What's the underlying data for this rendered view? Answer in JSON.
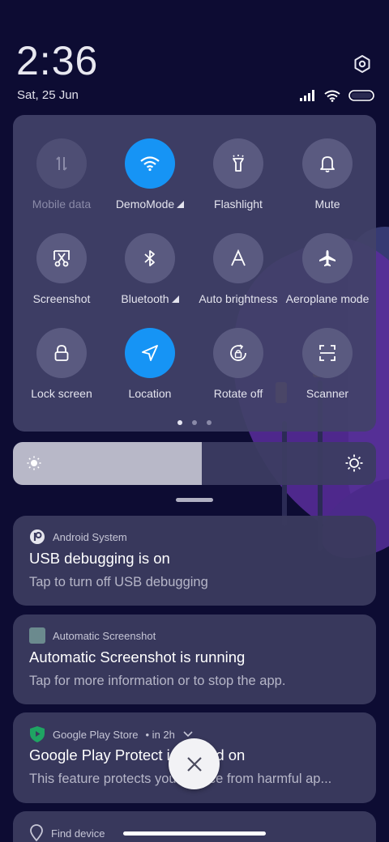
{
  "status": {
    "time": "2:36",
    "date": "Sat, 25 Jun"
  },
  "quick_settings": {
    "tiles": [
      {
        "label": "Mobile data",
        "icon": "mobile-data-icon",
        "state": "disabled"
      },
      {
        "label": "DemoMode",
        "icon": "wifi-icon",
        "state": "active",
        "expandable": true
      },
      {
        "label": "Flashlight",
        "icon": "flashlight-icon",
        "state": "off"
      },
      {
        "label": "Mute",
        "icon": "bell-icon",
        "state": "off"
      },
      {
        "label": "Screenshot",
        "icon": "screenshot-icon",
        "state": "off"
      },
      {
        "label": "Bluetooth",
        "icon": "bluetooth-icon",
        "state": "off",
        "expandable": true
      },
      {
        "label": "Auto brightness",
        "icon": "auto-brightness-icon",
        "state": "off"
      },
      {
        "label": "Aeroplane mode",
        "icon": "airplane-icon",
        "state": "off"
      },
      {
        "label": "Lock screen",
        "icon": "lock-icon",
        "state": "off"
      },
      {
        "label": "Location",
        "icon": "location-icon",
        "state": "active"
      },
      {
        "label": "Rotate off",
        "icon": "rotate-lock-icon",
        "state": "off"
      },
      {
        "label": "Scanner",
        "icon": "scanner-icon",
        "state": "off"
      }
    ],
    "page_count": 3,
    "current_page": 1
  },
  "brightness": {
    "level": 0.52
  },
  "notifications": [
    {
      "app": "Android System",
      "app_icon": "android-system-icon",
      "title": "USB debugging is on",
      "body": "Tap to turn off USB debugging"
    },
    {
      "app": "Automatic Screenshot",
      "app_icon": "automatic-screenshot-icon",
      "title": "Automatic Screenshot is running",
      "body": "Tap for more information or to stop the app."
    },
    {
      "app": "Google Play Store",
      "app_icon": "play-protect-icon",
      "meta": "• in 2h",
      "title": "Google Play Protect is turned on",
      "body": "This feature protects your device from harmful ap..."
    },
    {
      "app": "Find device",
      "app_icon": "find-device-icon"
    }
  ],
  "colors": {
    "accent": "#1694f5",
    "background": "#0d0c33",
    "panel": "#424268"
  }
}
